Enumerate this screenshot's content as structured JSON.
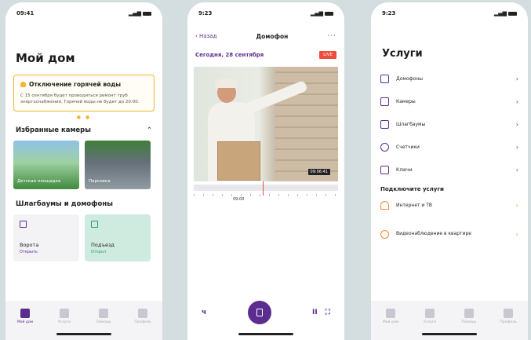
{
  "screen1": {
    "time": "09:41",
    "title": "Мой дом",
    "notice_title": "Отключение горячей воды",
    "notice_body": "С 15 сентября будет проводиться ремонт труб энергоснабжения. Горячей воды не будет до 20:00.",
    "cameras_title": "Избранные камеры",
    "cameras": [
      {
        "label": "Детская площадка"
      },
      {
        "label": "Парковка"
      }
    ],
    "barriers_title": "Шлагбаумы и домофоны",
    "tiles": [
      {
        "name": "Ворота",
        "status": "Открыть"
      },
      {
        "name": "Подъезд",
        "status": "Открыт"
      }
    ],
    "tabs": [
      {
        "label": "Мой дом"
      },
      {
        "label": "Услуги"
      },
      {
        "label": "Помощь"
      },
      {
        "label": "Профиль"
      }
    ]
  },
  "screen2": {
    "time": "9:23",
    "back": "‹ Назад",
    "title": "Домофон",
    "more": "···",
    "date": "Сегодня, 28 сентября",
    "live": "LIVE",
    "timestamp": "09:06:41",
    "timeline_time": "09:00",
    "left_ctrl": "ч",
    "pause": "II",
    "fullscreen": "⛶"
  },
  "screen3": {
    "time": "9:23",
    "title": "Услуги",
    "services": [
      {
        "label": "Домофоны"
      },
      {
        "label": "Камеры"
      },
      {
        "label": "Шлагбаумы"
      },
      {
        "label": "Счетчики"
      },
      {
        "label": "Ключи"
      }
    ],
    "connect_title": "Подключите услуги",
    "connect": [
      {
        "label": "Интернет и ТВ"
      },
      {
        "label": "Видеонаблюдение в квартире"
      }
    ],
    "tabs": [
      {
        "label": "Мой дом"
      },
      {
        "label": "Услуги"
      },
      {
        "label": "Помощь"
      },
      {
        "label": "Профиль"
      }
    ]
  }
}
